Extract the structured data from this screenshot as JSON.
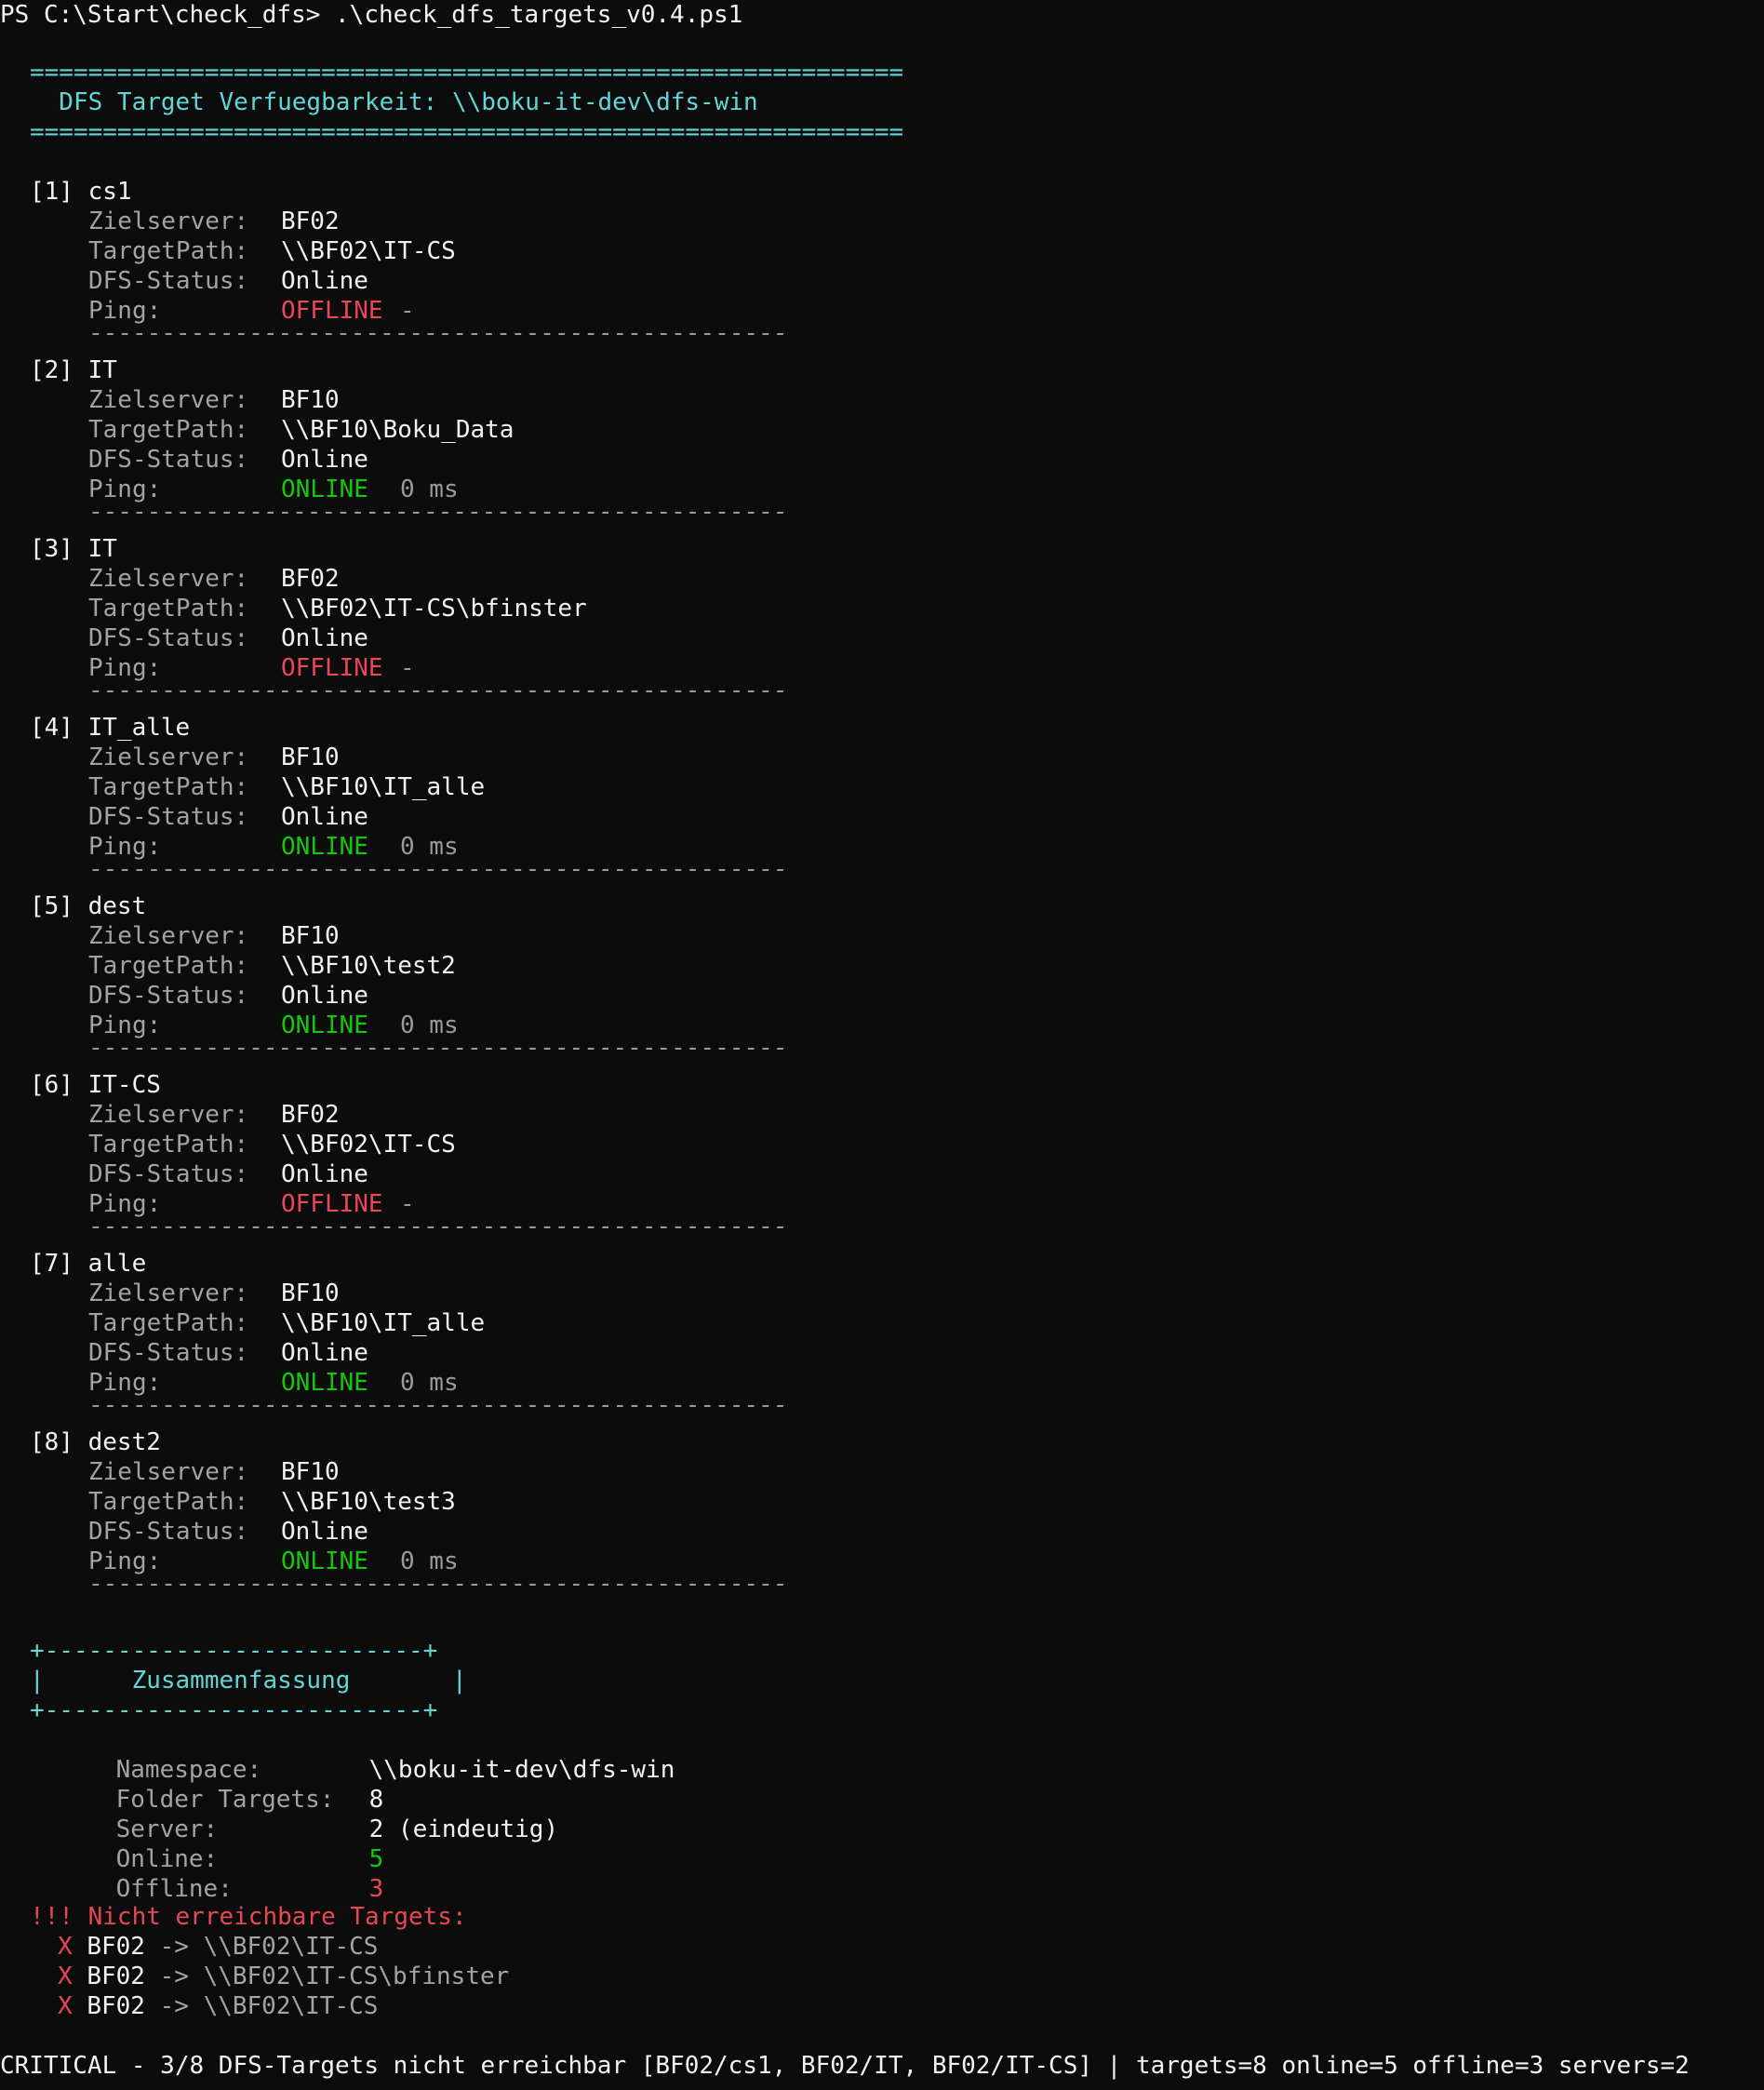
{
  "prompt": {
    "text": "PS C:\\Start\\check_dfs> .\\check_dfs_targets_v0.4.ps1"
  },
  "header": {
    "rule": "============================================================",
    "title": "  DFS Target Verfuegbarkeit: \\\\boku-it-dev\\dfs-win"
  },
  "labels": {
    "zielserver": "Zielserver:",
    "targetpath": "TargetPath:",
    "dfs_status": "DFS-Status:",
    "ping": "Ping:"
  },
  "separator": "------------------------------------------------",
  "targets": [
    {
      "index": "[1]",
      "name": "cs1",
      "server": "BF02",
      "path": "\\\\BF02\\IT-CS",
      "dfs_status": "Online",
      "ping_status": "OFFLINE",
      "ping_time": "-",
      "color": "#e74856"
    },
    {
      "index": "[2]",
      "name": "IT",
      "server": "BF10",
      "path": "\\\\BF10\\Boku_Data",
      "dfs_status": "Online",
      "ping_status": "ONLINE",
      "ping_time": "0 ms",
      "color": "#16c60c"
    },
    {
      "index": "[3]",
      "name": "IT",
      "server": "BF02",
      "path": "\\\\BF02\\IT-CS\\bfinster",
      "dfs_status": "Online",
      "ping_status": "OFFLINE",
      "ping_time": "-",
      "color": "#e74856"
    },
    {
      "index": "[4]",
      "name": "IT_alle",
      "server": "BF10",
      "path": "\\\\BF10\\IT_alle",
      "dfs_status": "Online",
      "ping_status": "ONLINE",
      "ping_time": "0 ms",
      "color": "#16c60c"
    },
    {
      "index": "[5]",
      "name": "dest",
      "server": "BF10",
      "path": "\\\\BF10\\test2",
      "dfs_status": "Online",
      "ping_status": "ONLINE",
      "ping_time": "0 ms",
      "color": "#16c60c"
    },
    {
      "index": "[6]",
      "name": "IT-CS",
      "server": "BF02",
      "path": "\\\\BF02\\IT-CS",
      "dfs_status": "Online",
      "ping_status": "OFFLINE",
      "ping_time": "-",
      "color": "#e74856"
    },
    {
      "index": "[7]",
      "name": "alle",
      "server": "BF10",
      "path": "\\\\BF10\\IT_alle",
      "dfs_status": "Online",
      "ping_status": "ONLINE",
      "ping_time": "0 ms",
      "color": "#16c60c"
    },
    {
      "index": "[8]",
      "name": "dest2",
      "server": "BF10",
      "path": "\\\\BF10\\test3",
      "dfs_status": "Online",
      "ping_status": "ONLINE",
      "ping_time": "0 ms",
      "color": "#16c60c"
    }
  ],
  "summary": {
    "box_top": "+--------------------------+",
    "box_title": "|      Zusammenfassung       |",
    "box_bottom": "+--------------------------+",
    "namespace_label": "Namespace:",
    "namespace_value": "\\\\boku-it-dev\\dfs-win",
    "targets_label": "Folder Targets:",
    "targets_value": "8",
    "server_label": "Server:",
    "server_value": "2 (eindeutig)",
    "online_label": "Online:",
    "online_value": "5",
    "offline_label": "Offline:",
    "offline_value": "3"
  },
  "unreachable": {
    "heading": "!!! Nicht erreichbare Targets:",
    "marker": "X",
    "arrow": "->",
    "items": [
      {
        "server": "BF02",
        "path": "\\\\BF02\\IT-CS"
      },
      {
        "server": "BF02",
        "path": "\\\\BF02\\IT-CS\\bfinster"
      },
      {
        "server": "BF02",
        "path": "\\\\BF02\\IT-CS"
      }
    ]
  },
  "result": {
    "text": "CRITICAL - 3/8 DFS-Targets nicht erreichbar [BF02/cs1, BF02/IT, BF02/IT-CS] | targets=8 online=5 offline=3 servers=2"
  },
  "colors": {
    "background": "#0c0c0c",
    "foreground": "#f2f2f2",
    "label": "#a3a3a3",
    "accent": "#61d6d6",
    "error": "#e74856",
    "ok": "#16c60c"
  }
}
